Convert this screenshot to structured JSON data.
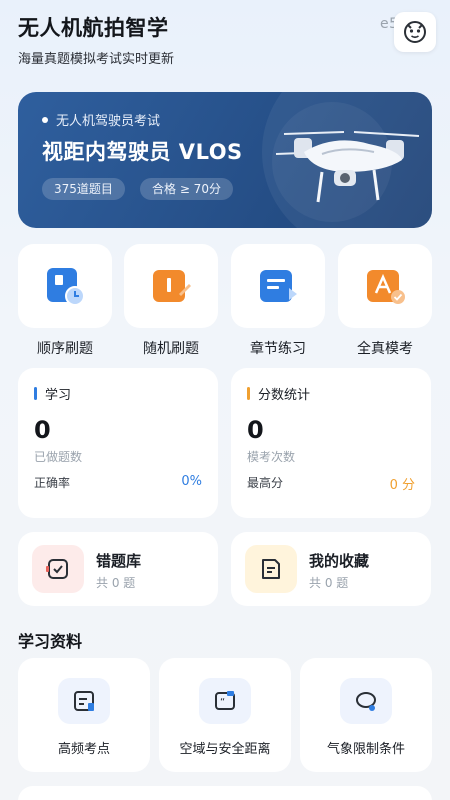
{
  "header": {
    "title": "无人机航拍智学",
    "subtitle": "海量真题模拟考试实时更新",
    "device_id": "e59c8"
  },
  "banner": {
    "exam_label": "无人机驾驶员考试",
    "title": "视距内驾驶员 VLOS",
    "question_count": "375道题目",
    "pass_score": "合格 ≥ 70分"
  },
  "quick_actions": [
    {
      "label": "顺序刷题",
      "icon": "sequential-practice-icon"
    },
    {
      "label": "随机刷题",
      "icon": "random-practice-icon"
    },
    {
      "label": "章节练习",
      "icon": "chapter-practice-icon"
    },
    {
      "label": "全真模考",
      "icon": "mock-exam-icon"
    }
  ],
  "study_stats": {
    "heading": "学习",
    "count": "0",
    "count_caption": "已做题数",
    "rate_label": "正确率",
    "rate_value": "0%"
  },
  "score_stats": {
    "heading": "分数统计",
    "count": "0",
    "count_caption": "模考次数",
    "best_label": "最高分",
    "best_value": "0 分"
  },
  "wrong_book": {
    "title": "错题库",
    "count": "共 0 题"
  },
  "favorites": {
    "title": "我的收藏",
    "count": "共 0 题"
  },
  "materials": {
    "heading": "学习资料",
    "items": [
      {
        "label": "高频考点",
        "icon": "document-icon"
      },
      {
        "label": "空域与安全距离",
        "icon": "quote-icon"
      },
      {
        "label": "气象限制条件",
        "icon": "chat-bubble-icon"
      }
    ]
  },
  "colors": {
    "accent_blue": "#2f7de1",
    "accent_orange": "#f0a030",
    "banner_bg": "#28538d"
  }
}
